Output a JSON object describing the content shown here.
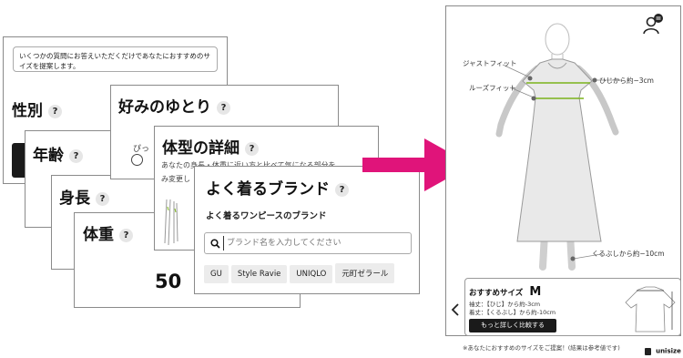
{
  "cards": {
    "gender": {
      "intro": "いくつかの質問にお答えいただくだけであなたにおすすめのサイズを提案します。",
      "title": "性別"
    },
    "age": {
      "title": "年齢"
    },
    "height": {
      "title": "身長"
    },
    "weight": {
      "title": "体重",
      "value": "50"
    },
    "fit_pref": {
      "title": "好みのゆとり",
      "option_label": "ぴっ"
    },
    "body_detail": {
      "title": "体型の詳細",
      "desc": "あなたの身長・体重に近い方と比べて気になる部分を",
      "desc2": "み変更し"
    },
    "brand": {
      "title": "よく着るブランド",
      "subtitle": "よく着るワンピースのブランド",
      "search_placeholder": "ブランド名を入力してください",
      "chips": [
        "GU",
        "Style Ravie",
        "UNIQLO",
        "元町ゼラール"
      ]
    }
  },
  "help_mark": "?",
  "result": {
    "labels": {
      "just_fit": "ジャストフィット",
      "loose_fit": "ルーズフィット",
      "elbow": "ひじから約−3cm",
      "calf": "くるぶしから約−10cm"
    },
    "size_label": "おすすめサイズ",
    "size": "M",
    "sleeve": "袖丈：【ひじ】から約-3cm",
    "length": "着丈：【くるぶし】から約-10cm",
    "detail_button": "もっと詳しく比較する",
    "note": "※あなたにおすすめのサイズをご提案！(結果は参考値です)",
    "brand": "unisize"
  },
  "colors": {
    "arrow": "#e0147a",
    "fit_line": "#7bb31a",
    "dark_button": "#1a1a1a"
  }
}
